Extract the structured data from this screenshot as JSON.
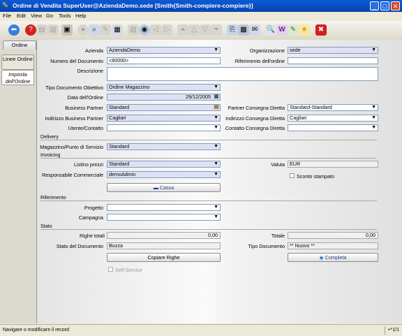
{
  "window": {
    "title": "Ordine di Vendita  SuperUser@AziendaDemo.sede [Smith{Smith-compiere-compiere}]"
  },
  "menu": [
    "File",
    "Edit",
    "View",
    "Go",
    "Tools",
    "Help"
  ],
  "toolbar": [
    "back-icon",
    "help-icon",
    "new-icon",
    "delete-icon",
    "save-icon",
    "refresh-icon",
    "find-icon",
    "attachment-icon",
    "history-icon",
    "report-icon",
    "print-icon",
    "previous-icon",
    "next-icon",
    "first-icon",
    "up-icon",
    "down-icon",
    "last-icon",
    "zoom-icon",
    "archive-icon",
    "requests-icon",
    "product-info-icon",
    "workflow-icon",
    "tree-icon",
    "favorite-icon",
    "exit-icon"
  ],
  "tabs": {
    "header": "Ordine",
    "lines": "Linee Ordine",
    "tax": "Imposta dell'Ordine"
  },
  "labels": {
    "azienda": "Azienda",
    "organizzazione": "Organizzazione",
    "numero": "Numero del Documento",
    "riferimento": "Riferimento dell'ordine",
    "descrizione": "Descrizione",
    "tipo_doc_obiettivo": "Tipo Documento Obiettivo",
    "data_ordine": "Data dell'Ordine",
    "business_partner": "Business Partner",
    "partner_consegna": "Partner Consegna Diretta",
    "indirizzo_bp": "Indirizzo Business Partner",
    "indirizzo_consegna": "Indirizzo Consegna Diretta",
    "utente": "Utente/Contatto",
    "contatto_consegna": "Contatto Consegna Diretta",
    "magazzino": "Magazzino/Punto di Servizio",
    "listino": "Listino prezzi",
    "valuta": "Valuta",
    "responsabile": "Responsabile Commerciale",
    "sconto": "Sconto stampato",
    "progetto": "Progetto",
    "campagna": "Campagna",
    "righe_totali": "Righe totali",
    "totale": "Totale",
    "stato_doc": "Stato del Documento",
    "tipo_doc": "Tipo Documento",
    "self_service": "Self-Service"
  },
  "sections": {
    "delivery": "Delivery",
    "invoicing": "Invoicing",
    "riferimento": "Riferimento",
    "stato": "Stato"
  },
  "values": {
    "azienda": "AziendaDemo",
    "organizzazione": "sede",
    "numero": "<80000>",
    "riferimento": "",
    "descrizione": "",
    "tipo_doc_obiettivo": "Ordine Magazzino",
    "data_ordine": "29/12/2005",
    "business_partner": "Standard",
    "partner_consegna": "Standard-Standard",
    "indirizzo_bp": "Cagliari",
    "indirizzo_consegna": "Cagliari",
    "utente": "",
    "contatto_consegna": "",
    "magazzino": "Standard",
    "listino": "Standard",
    "valuta": "EUR",
    "responsabile": "demoAdmin",
    "progetto": "",
    "campagna": "",
    "righe_totali": "0,00",
    "totale": "0,00",
    "stato_doc": "Bozza",
    "tipo_doc": "** Nuovo **"
  },
  "buttons": {
    "cassa": "Cassa",
    "copiare": "Copiare Righe",
    "completa": "Completa"
  },
  "status": {
    "message": "Navigare o modificare il record",
    "record": "+*1/1"
  }
}
